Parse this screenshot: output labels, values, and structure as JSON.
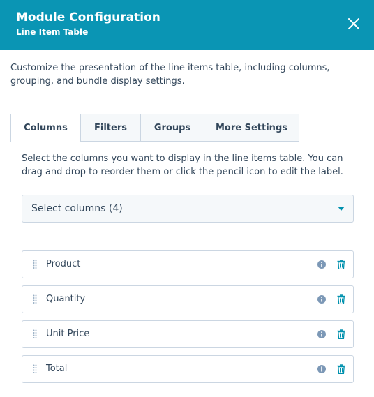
{
  "header": {
    "title": "Module Configuration",
    "subtitle": "Line Item Table",
    "close_icon": "close-icon",
    "background_color": "#0a95b4"
  },
  "description": "Customize the presentation of the line items table, including columns, grouping, and bundle display settings.",
  "tabs": [
    {
      "label": "Columns",
      "active": true
    },
    {
      "label": "Filters",
      "active": false
    },
    {
      "label": "Groups",
      "active": false
    },
    {
      "label": "More Settings",
      "active": false
    }
  ],
  "columns_tab": {
    "instructions": "Select the columns you want to display in the line items table. You can drag and drop to reorder them or click the pencil icon to edit the label.",
    "select_label": "Select columns (4)",
    "items": [
      {
        "label": "Product"
      },
      {
        "label": "Quantity"
      },
      {
        "label": "Unit Price"
      },
      {
        "label": "Total"
      }
    ]
  },
  "icons": {
    "drag": "drag-handle-icon",
    "info": "info-icon",
    "delete": "trash-icon",
    "dropdown": "caret-down-icon"
  },
  "colors": {
    "accent": "#0091ae",
    "icon_gray": "#7c98b6",
    "border": "#cbd6e2",
    "text": "#33475b"
  }
}
